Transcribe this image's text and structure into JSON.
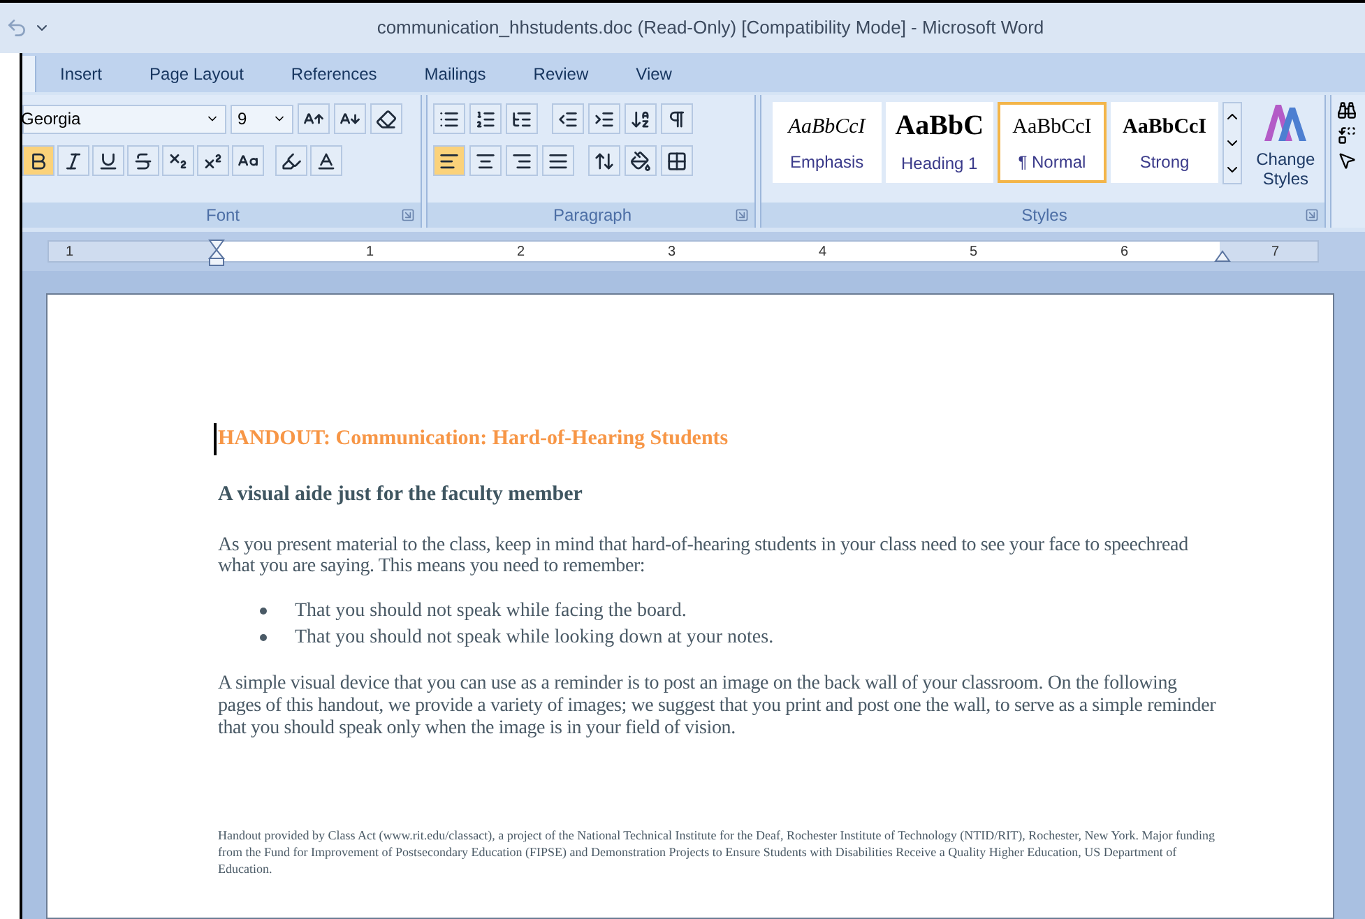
{
  "window": {
    "title": "communication_hhstudents.doc (Read-Only) [Compatibility Mode] - Microsoft Word"
  },
  "tabs": [
    {
      "label": "Insert",
      "selected": false
    },
    {
      "label": "Page Layout",
      "selected": false
    },
    {
      "label": "References",
      "selected": false
    },
    {
      "label": "Mailings",
      "selected": false
    },
    {
      "label": "Review",
      "selected": false
    },
    {
      "label": "View",
      "selected": false
    }
  ],
  "font_group": {
    "label": "Font",
    "font_name": "Georgia",
    "font_size": "9",
    "format_buttons": [
      {
        "kind": "bold",
        "active": true
      },
      {
        "kind": "italic",
        "active": false
      },
      {
        "kind": "underline",
        "active": false
      },
      {
        "kind": "strike",
        "active": false
      },
      {
        "kind": "subscript",
        "active": false
      },
      {
        "kind": "superscript",
        "active": false
      },
      {
        "kind": "case",
        "active": false
      }
    ]
  },
  "paragraph_group": {
    "label": "Paragraph",
    "alignments": [
      {
        "kind": "left",
        "selected": true
      },
      {
        "kind": "center",
        "selected": false
      },
      {
        "kind": "right",
        "selected": false
      },
      {
        "kind": "justify",
        "selected": false
      }
    ]
  },
  "styles_group": {
    "label": "Styles",
    "change_styles": "Change Styles",
    "styles": [
      {
        "preview": "AaBbCcI",
        "label": "Emphasis",
        "kind": "emphasis",
        "selected": false
      },
      {
        "preview": "AaBbC",
        "label": "Heading 1",
        "kind": "heading",
        "selected": false
      },
      {
        "preview": "AaBbCcI",
        "label": "¶ Normal",
        "kind": "normal",
        "selected": true
      },
      {
        "preview": "AaBbCcI",
        "label": "Strong",
        "kind": "strong",
        "selected": false
      }
    ]
  },
  "ruler": {
    "labels": [
      "1",
      "1",
      "2",
      "3",
      "4",
      "5",
      "6",
      "7"
    ]
  },
  "document": {
    "title": "HANDOUT: Communication: Hard-of-Hearing Students",
    "subtitle": "A visual aide just for the faculty member",
    "intro": "As you present material to the class, keep in mind that hard-of-hearing students in your class need to see your face to speechread what you are saying. This means you need to remember:",
    "bullets": [
      "That you should not speak while facing the board.",
      "That you should not speak while looking down at your notes."
    ],
    "body": "A simple visual device that you can use as a reminder is to post an image on the back wall of your classroom. On the following pages of this handout, we provide a variety of images; we suggest that you print and post one the wall, to serve as a simple reminder that you should speak only when the image is in your field of vision.",
    "footer": "Handout provided by Class Act (www.rit.edu/classact), a project of the National Technical Institute for the Deaf, Rochester Institute of Technology (NTID/RIT), Rochester, New York. Major funding from the Fund for Improvement of Postsecondary Education (FIPSE) and Demonstration Projects to Ensure Students with Disabilities Receive a Quality Higher Education, US Department of Education."
  }
}
